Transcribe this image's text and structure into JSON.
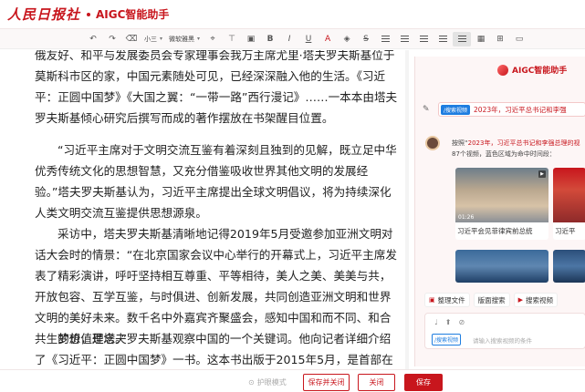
{
  "header": {
    "logo_text": "人民日报社",
    "app_title": "AIGC智能助手"
  },
  "toolbar": {
    "undo": "↶",
    "redo": "↷",
    "format_painter": "⌫",
    "font_size": "小三",
    "font_family": "微软雅黑",
    "bold": "B",
    "italic": "I",
    "underline": "U",
    "strike": "S",
    "font_color": "A",
    "highlight": "◈"
  },
  "document": {
    "paragraphs": [
      "俄友好、和平与发展委员会专家理事会我万主席尤里·塔夫罗夫斯基位于莫斯科市区的家，中国元素随处可见，已经深深融入他的生活。《习近平：正圆中国梦》《大国之翼：“一带一路”西行漫记》……一本本由塔夫罗夫斯基倾心研究后撰写而成的著作摆放在书架醒目位置。",
      "“习近平主席对于文明交流互鉴有着深刻且独到的见解，既立足中华优秀传统文化的思想智慧，又充分借鉴吸收世界其他文明的发展经验。”塔夫罗夫斯基认为，习近平主席提出全球文明倡议，将为持续深化人类文明交流互鉴提供思想源泉。",
      "采访中，塔夫罗夫斯基清晰地记得2019年5月受邀参加亚洲文明对话大会时的情景：“在北京国家会议中心举行的开幕式上，习近平主席发表了精彩演讲，呼吁坚持相互尊重、平等相待，美人之美、美美与共，开放包容、互学互鉴，与时俱进、创新发展，共同创造亚洲文明和世界文明的美好未来。数千名中外嘉宾齐聚盛会，感知中国和而不同、和合共生的价值理念。”",
      "梦想，是塔夫罗夫斯基观察中国的一个关键词。他向记者详细介绍了《习近平：正圆中国梦》一书。这本书出版于2015年5月，是首部在俄罗斯出版的关于习"
    ]
  },
  "panel": {
    "title": "AIGC智能助手",
    "query_tag": "/搜索视频",
    "query_text": "2023年，习近平总书记和李强",
    "response_prefix": "按照“",
    "response_highlight": "2023年，习近平总书记和李强总理的视",
    "response_line2": "87个视频，蓝色区域为命中时间段：",
    "videos": [
      {
        "caption": "习近平会见菲律宾前总统",
        "duration": "01:26"
      },
      {
        "caption": "习近平",
        "duration": ""
      },
      {
        "caption": "",
        "duration": ""
      },
      {
        "caption": "",
        "duration": ""
      }
    ],
    "chips": [
      "整理文件",
      "版面搜索",
      "搜索视频"
    ],
    "input_tag": "/搜索视频",
    "input_placeholder": "请输入搜索视频的条件"
  },
  "footer": {
    "eye_mode": "护眼模式",
    "save_close": "保存并关闭",
    "close": "关闭",
    "save": "保存"
  },
  "colors": {
    "brand_red": "#c8161d",
    "tag_blue": "#1e7de0"
  }
}
